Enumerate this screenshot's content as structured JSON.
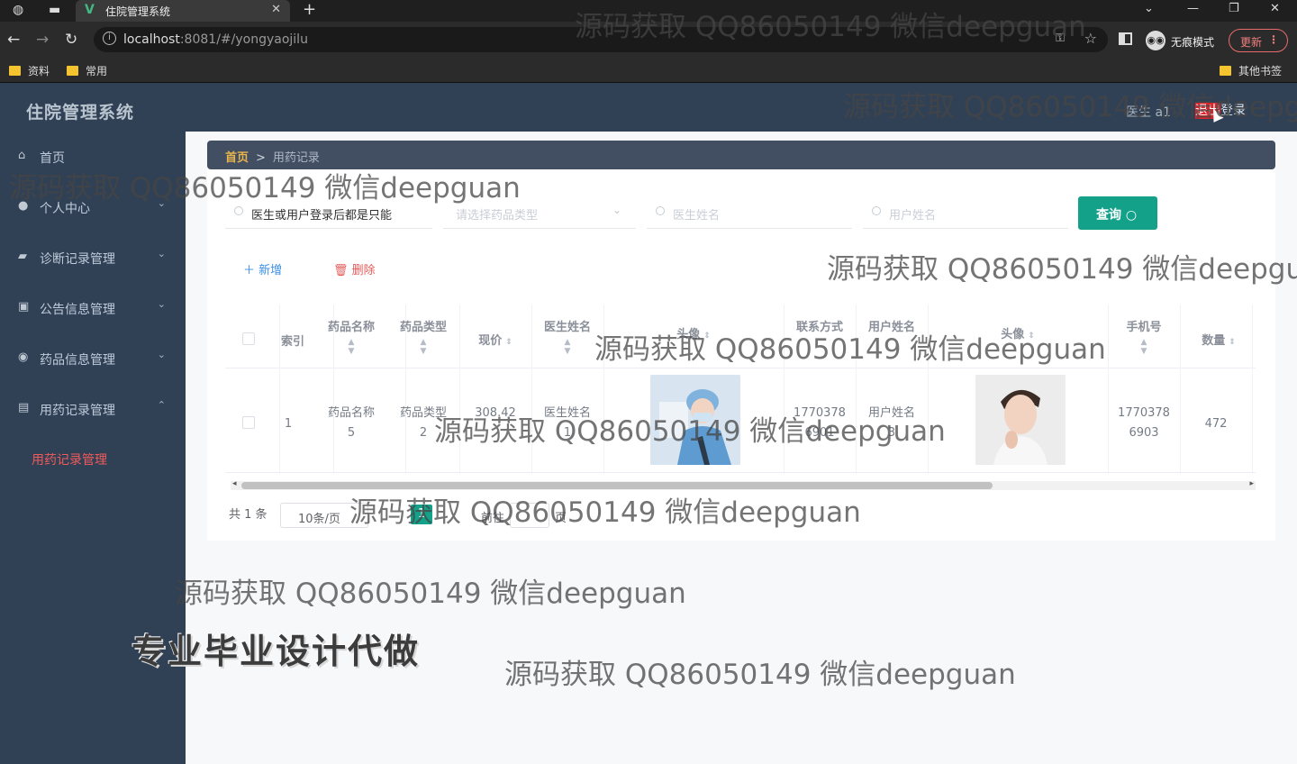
{
  "browser": {
    "tab_title": "住院管理系统",
    "tab_icon": "V",
    "url_host": "localhost",
    "url_rest": ":8081/#/yongyaojilu",
    "incognito_label": "无痕模式",
    "update_label": "更新",
    "bookmarks": [
      "资料",
      "常用"
    ],
    "other_bookmarks": "其他书签"
  },
  "header": {
    "app_title": "住院管理系统",
    "user_info": "医生 a1",
    "logout_highlight": "退出",
    "logout_rest": "登录"
  },
  "sidebar": {
    "items": [
      {
        "label": "首页",
        "icon": "home-icon"
      },
      {
        "label": "个人中心",
        "icon": "user-icon"
      },
      {
        "label": "诊断记录管理",
        "icon": "chat-icon"
      },
      {
        "label": "公告信息管理",
        "icon": "clipboard-icon"
      },
      {
        "label": "药品信息管理",
        "icon": "pin-icon"
      },
      {
        "label": "用药记录管理",
        "icon": "checklist-icon"
      }
    ],
    "active_sub": "用药记录管理"
  },
  "breadcrumb": {
    "home": "首页",
    "sep": ">",
    "current": "用药记录"
  },
  "search": {
    "field1_value": "医生或用户登录后都是只能",
    "field2_placeholder": "请选择药品类型",
    "field3_placeholder": "医生姓名",
    "field4_placeholder": "用户姓名",
    "query_label": "查询"
  },
  "actions": {
    "add_label": "新增",
    "delete_label": "删除"
  },
  "table": {
    "headers": {
      "index": "索引",
      "drug_name": "药品名称",
      "drug_type": "药品类型",
      "price": "现价",
      "doctor_name": "医生姓名",
      "doctor_avatar": "头像",
      "contact": "联系方式",
      "user_name": "用户姓名",
      "avatar": "头像",
      "phone": "手机号",
      "quantity": "数量"
    },
    "rows": [
      {
        "index": "1",
        "drug_name_1": "药品名称",
        "drug_name_2": "5",
        "drug_type_1": "药品类型",
        "drug_type_2": "2",
        "price": "308.42",
        "doctor_name_1": "医生姓名",
        "doctor_name_2": "1",
        "contact_1": "1770378",
        "contact_2": "6901",
        "user_name_1": "用户姓名",
        "user_name_2": "3",
        "phone_1": "1770378",
        "phone_2": "6903",
        "quantity": "472"
      }
    ]
  },
  "pagination": {
    "total": "共 1 条",
    "page_size": "10条/页",
    "current_page": "1",
    "goto_label": "前往",
    "page_label": "页"
  },
  "watermark": {
    "text": "源码获取 QQ86050149 微信deepguan",
    "promo": "专业毕业设计代做"
  }
}
